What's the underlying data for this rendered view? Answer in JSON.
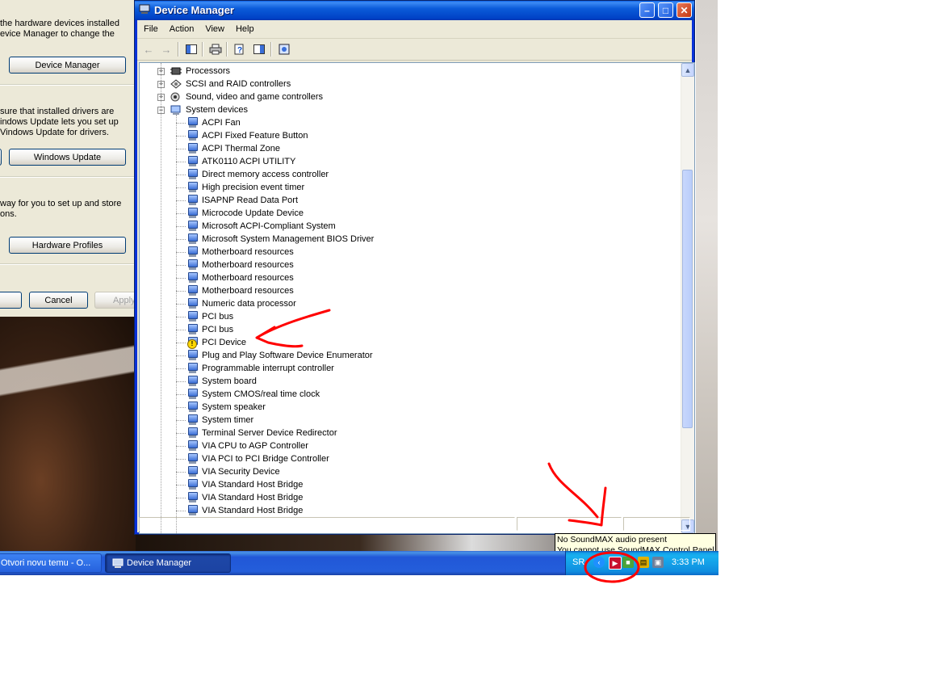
{
  "system_properties": {
    "hardware_text": "the hardware devices installed\nevice Manager to change the",
    "device_manager_button": "Device Manager",
    "drivers_text": "sure that installed drivers are\nindows Update lets you set up\nVindows Update for drivers.",
    "windows_update_button": "Windows Update",
    "profiles_text": "way for you to set up and store\nons.",
    "hardware_profiles_button": "Hardware Profiles",
    "cancel_button": "Cancel",
    "apply_button": "Apply"
  },
  "window": {
    "title": "Device Manager",
    "minimize": "–",
    "maximize": "□",
    "close": "✕"
  },
  "menu": [
    "File",
    "Action",
    "View",
    "Help"
  ],
  "toolbar_icons": [
    "back-arrow-icon",
    "forward-arrow-icon",
    "console-tree-icon",
    "print-icon",
    "help-icon",
    "properties-icon",
    "scan-hardware-icon"
  ],
  "tree": {
    "categories": [
      {
        "label": "Processors",
        "expander": "+",
        "icon": "processor-icon"
      },
      {
        "label": "SCSI and RAID controllers",
        "expander": "+",
        "icon": "scsi-icon"
      },
      {
        "label": "Sound, video and game controllers",
        "expander": "+",
        "icon": "sound-icon"
      },
      {
        "label": "System devices",
        "expander": "−",
        "icon": "computer-icon"
      }
    ],
    "system_devices": [
      {
        "label": "ACPI Fan",
        "warning": false
      },
      {
        "label": "ACPI Fixed Feature Button",
        "warning": false
      },
      {
        "label": "ACPI Thermal Zone",
        "warning": false
      },
      {
        "label": "ATK0110 ACPI UTILITY",
        "warning": false
      },
      {
        "label": "Direct memory access controller",
        "warning": false
      },
      {
        "label": "High precision event timer",
        "warning": false
      },
      {
        "label": "ISAPNP Read Data Port",
        "warning": false
      },
      {
        "label": "Microcode Update Device",
        "warning": false
      },
      {
        "label": "Microsoft ACPI-Compliant System",
        "warning": false
      },
      {
        "label": "Microsoft System Management BIOS Driver",
        "warning": false
      },
      {
        "label": "Motherboard resources",
        "warning": false
      },
      {
        "label": "Motherboard resources",
        "warning": false
      },
      {
        "label": "Motherboard resources",
        "warning": false
      },
      {
        "label": "Motherboard resources",
        "warning": false
      },
      {
        "label": "Numeric data processor",
        "warning": false
      },
      {
        "label": "PCI bus",
        "warning": false
      },
      {
        "label": "PCI bus",
        "warning": false
      },
      {
        "label": "PCI Device",
        "warning": true
      },
      {
        "label": "Plug and Play Software Device Enumerator",
        "warning": false
      },
      {
        "label": "Programmable interrupt controller",
        "warning": false
      },
      {
        "label": "System board",
        "warning": false
      },
      {
        "label": "System CMOS/real time clock",
        "warning": false
      },
      {
        "label": "System speaker",
        "warning": false
      },
      {
        "label": "System timer",
        "warning": false
      },
      {
        "label": "Terminal Server Device Redirector",
        "warning": false
      },
      {
        "label": "VIA CPU to AGP Controller",
        "warning": false
      },
      {
        "label": "VIA PCI to PCI Bridge Controller",
        "warning": false
      },
      {
        "label": "VIA Security Device",
        "warning": false
      },
      {
        "label": "VIA Standard Host Bridge",
        "warning": false
      },
      {
        "label": "VIA Standard Host Bridge",
        "warning": false
      },
      {
        "label": "VIA Standard Host Bridge",
        "warning": false
      }
    ]
  },
  "tooltip": {
    "line1": "No SoundMAX audio present",
    "line2": "You cannot use SoundMAX Control Panel"
  },
  "taskbar": {
    "buttons": [
      {
        "label": "Otvori novu temu - O...",
        "active": false
      },
      {
        "label": "Device Manager",
        "active": true
      }
    ],
    "language": "SR",
    "clock": "3:33 PM"
  },
  "colors": {
    "title_blue": "#0054e3",
    "annotation_red": "#ff0000",
    "tooltip_bg": "#ffffe1"
  }
}
